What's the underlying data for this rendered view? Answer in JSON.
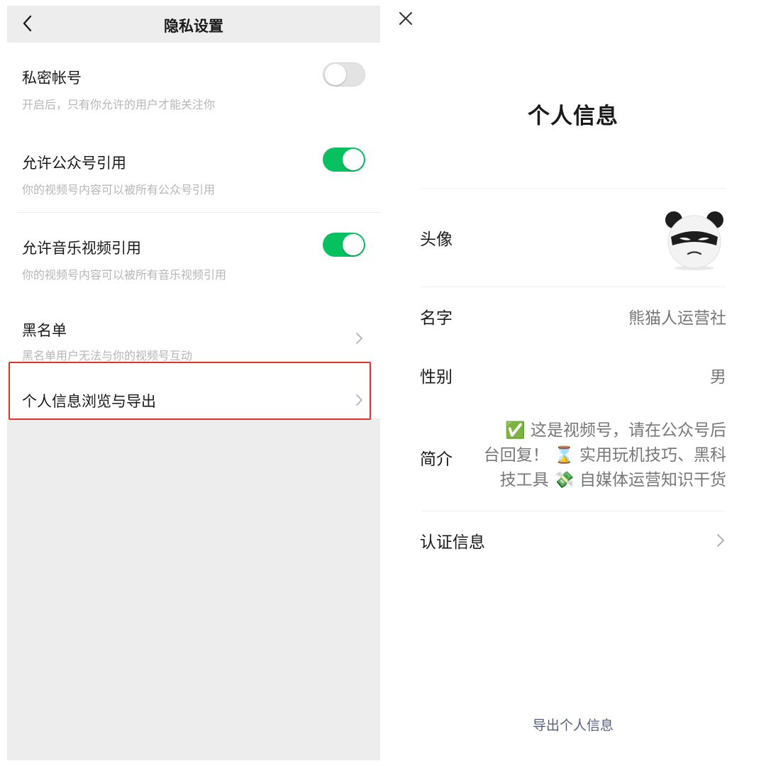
{
  "left": {
    "nav": {
      "title": "隐私设置",
      "back_icon": "chevron-left-icon"
    },
    "rows": [
      {
        "title": "私密帐号",
        "desc": "开启后，只有你允许的用户才能关注你",
        "control": "toggle",
        "on": false
      },
      {
        "title": "允许公众号引用",
        "desc": "你的视频号内容可以被所有公众号引用",
        "control": "toggle",
        "on": true
      },
      {
        "title": "允许音乐视频引用",
        "desc": "你的视频号内容可以被所有音乐视频引用",
        "control": "toggle",
        "on": true
      },
      {
        "title": "黑名单",
        "desc": "黑名单用户无法与你的视频号互动",
        "control": "chevron"
      },
      {
        "title": "个人信息浏览与导出",
        "control": "chevron",
        "highlighted": true
      }
    ],
    "colors": {
      "toggle_on": "#07c160",
      "highlight": "#e0322b",
      "background": "#ededed"
    }
  },
  "right": {
    "close_icon": "close-icon",
    "title": "个人信息",
    "avatar": {
      "label": "头像",
      "icon": "panda-avatar-icon"
    },
    "name": {
      "label": "名字",
      "value": "熊猫人运营社"
    },
    "gender": {
      "label": "性别",
      "value": "男"
    },
    "bio": {
      "label": "简介",
      "lines": [
        "✅ 这是视频号，请在公众号后",
        "台回复！ ⌛ 实用玩机技巧、黑科",
        "技工具 💸 自媒体运营知识干货"
      ]
    },
    "certification": {
      "label": "认证信息"
    },
    "export_label": "导出个人信息"
  }
}
